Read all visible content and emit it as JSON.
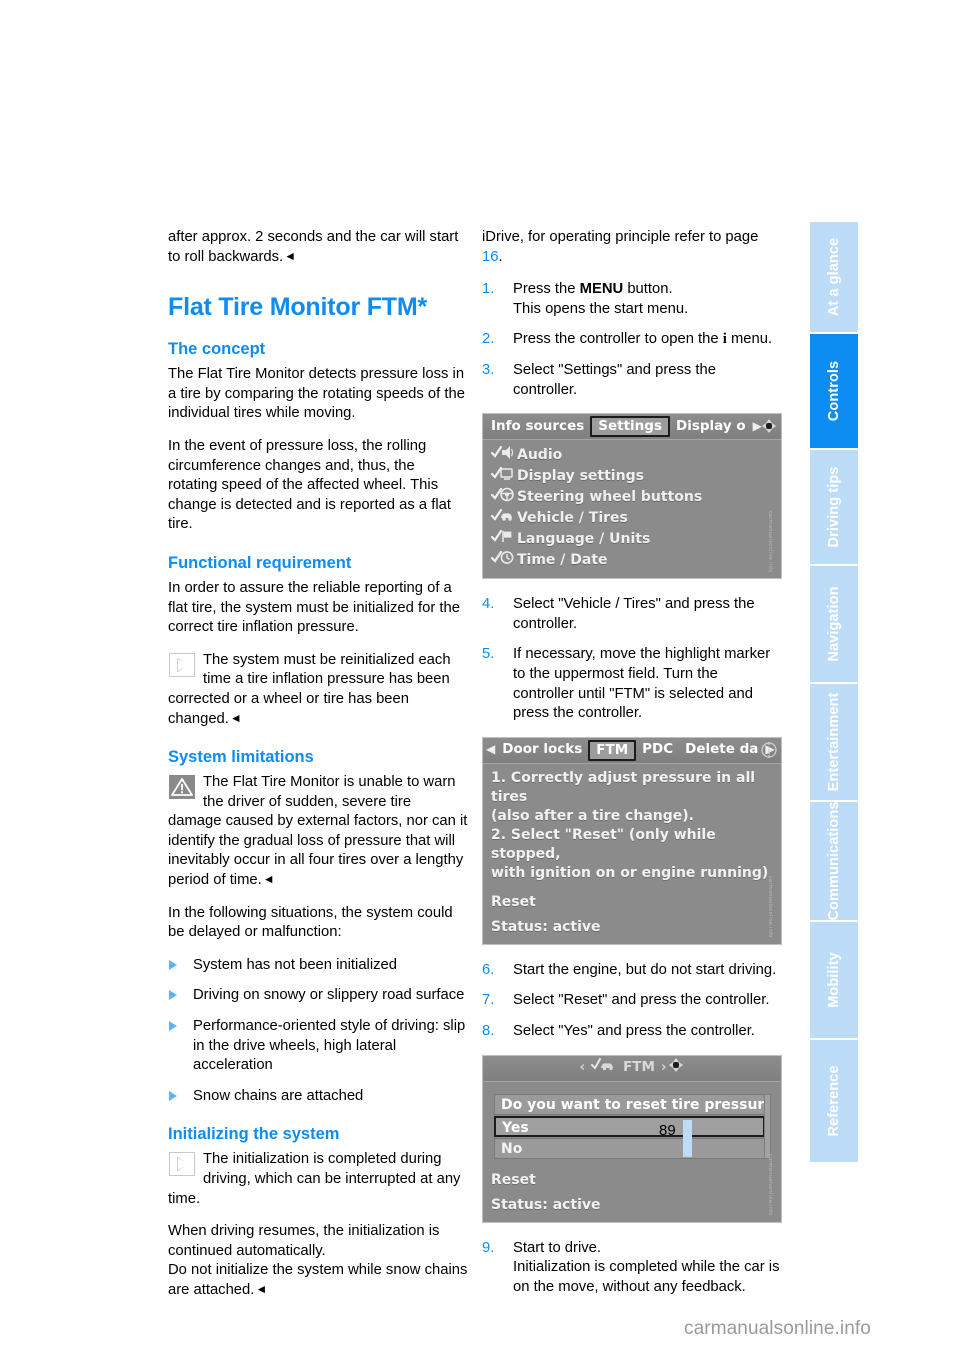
{
  "document": {
    "page_number": "89",
    "watermark_site": "carmanualsonline.info",
    "image_codes": [
      "carmanualsonline.info",
      "carmanualsonline.info",
      "carmanualsonline.info"
    ]
  },
  "sidebar": {
    "tabs": [
      {
        "label": "At a glance",
        "active": false
      },
      {
        "label": "Controls",
        "active": true
      },
      {
        "label": "Driving tips",
        "active": false
      },
      {
        "label": "Navigation",
        "active": false
      },
      {
        "label": "Entertainment",
        "active": false
      },
      {
        "label": "Communications",
        "active": false
      },
      {
        "label": "Mobility",
        "active": false
      },
      {
        "label": "Reference",
        "active": false
      }
    ]
  },
  "left_column": {
    "intro_para": "after approx. 2 seconds and the car will start to roll backwards.",
    "chapter_title": "Flat Tire Monitor FTM*",
    "sections": [
      {
        "heading": "The concept",
        "paragraphs": [
          "The Flat Tire Monitor detects pressure loss in a tire by comparing the rotating speeds of the individual tires while moving.",
          "In the event of pressure loss, the rolling circumference changes and, thus, the rotating speed of the affected wheel. This change is detected and is reported as a flat tire."
        ]
      },
      {
        "heading": "Functional requirement",
        "paragraphs": [
          "In order to assure the reliable reporting of a flat tire, the system must be initialized for the correct tire inflation pressure."
        ],
        "note": "The system must be reinitialized each time a tire inflation pressure has been corrected or a wheel or tire has been changed."
      },
      {
        "heading": "System limitations",
        "warning": "The Flat Tire Monitor is unable to warn the driver of sudden, severe tire damage caused by external factors, nor can it identify the gradual loss of pressure that will inevitably occur in all four tires over a lengthy period of time.",
        "lead_in": "In the following situations, the system could be delayed or malfunction:",
        "bullets": [
          "System has not been initialized",
          "Driving on snowy or slippery road surface",
          "Performance-oriented style of driving: slip in the drive wheels, high lateral acceleration",
          "Snow chains are attached"
        ]
      },
      {
        "heading": "Initializing the system",
        "note": "The initialization is completed during driving, which can be interrupted at any time.",
        "paragraphs": [
          "When driving resumes, the initialization is continued automatically.",
          "Do not initialize the system while snow chains are attached."
        ]
      }
    ]
  },
  "right_column": {
    "intro": {
      "text_before": "iDrive, for operating principle refer to page ",
      "page_ref": "16",
      "text_after": "."
    },
    "steps_1_3": [
      {
        "num": "1.",
        "line1_before": "Press the ",
        "bold": "MENU",
        "line1_after": " button.",
        "line2": "This opens the start menu."
      },
      {
        "num": "2.",
        "line1_before": "Press the controller to open the ",
        "bold": "i",
        "line1_after": " menu.",
        "line2": ""
      },
      {
        "num": "3.",
        "line1_before": "Select \"Settings\" and press the controller.",
        "bold": "",
        "line1_after": "",
        "line2": ""
      }
    ],
    "steps_4_5": [
      {
        "num": "4.",
        "text": "Select \"Vehicle / Tires\" and press the controller."
      },
      {
        "num": "5.",
        "text": "If necessary, move the highlight marker to the uppermost field. Turn the controller until \"FTM\" is selected and press the controller."
      }
    ],
    "steps_6_8": [
      {
        "num": "6.",
        "text": "Start the engine, but do not start driving."
      },
      {
        "num": "7.",
        "text": "Select \"Reset\" and press the controller."
      },
      {
        "num": "8.",
        "text": "Select \"Yes\" and press the controller."
      }
    ],
    "steps_9": [
      {
        "num": "9.",
        "line1": "Start to drive.",
        "line2": "Initialization is completed while the car is on the move, without any feedback."
      }
    ]
  },
  "screenshots": {
    "settings_menu": {
      "tabs": [
        {
          "label": "Info sources",
          "selected": false
        },
        {
          "label": "Settings",
          "selected": true
        },
        {
          "label": "Display o",
          "selected": false
        }
      ],
      "arrow": "▶",
      "knob_icon": "controller-knob-icon",
      "items": [
        {
          "icon": "check-speaker-icon",
          "label": "Audio"
        },
        {
          "icon": "check-display-icon",
          "label": "Display settings"
        },
        {
          "icon": "check-steering-wheel-icon",
          "label": "Steering wheel buttons"
        },
        {
          "icon": "check-car-icon",
          "label": "Vehicle / Tires"
        },
        {
          "icon": "check-flag-icon",
          "label": "Language / Units"
        },
        {
          "icon": "check-clock-icon",
          "label": "Time / Date"
        }
      ]
    },
    "ftm_menu": {
      "left_arrow": "◀",
      "right_arrow": "▶",
      "tabs": [
        {
          "label": "Door locks",
          "selected": false
        },
        {
          "label": "FTM",
          "selected": true
        },
        {
          "label": "PDC",
          "selected": false
        },
        {
          "label": "Delete da",
          "selected": false
        }
      ],
      "knob_icon": "info-knob-icon",
      "message_lines": [
        "1. Correctly adjust pressure in all tires",
        "(also after a tire change).",
        "2. Select \"Reset\" (only while stopped,",
        "with ignition on or engine running)"
      ],
      "reset_label": "Reset",
      "status_label": "Status: active"
    },
    "reset_dialog": {
      "left_arrow": "‹",
      "right_arrow": "›",
      "title_icon": "check-car-icon",
      "title": "FTM",
      "knob_icon": "controller-knob-icon",
      "question": "Do you want to reset tire pressur",
      "options": [
        {
          "label": "Yes",
          "selected": true
        },
        {
          "label": "No",
          "selected": false
        }
      ],
      "reset_label": "Reset",
      "status_label": "Status:  active"
    }
  },
  "colors": {
    "accent_blue": "#0d8cf2",
    "tab_inactive": "#bcdcf8",
    "screen_gray": "#8b8b8b",
    "footer_gray": "#9a9a9a"
  }
}
